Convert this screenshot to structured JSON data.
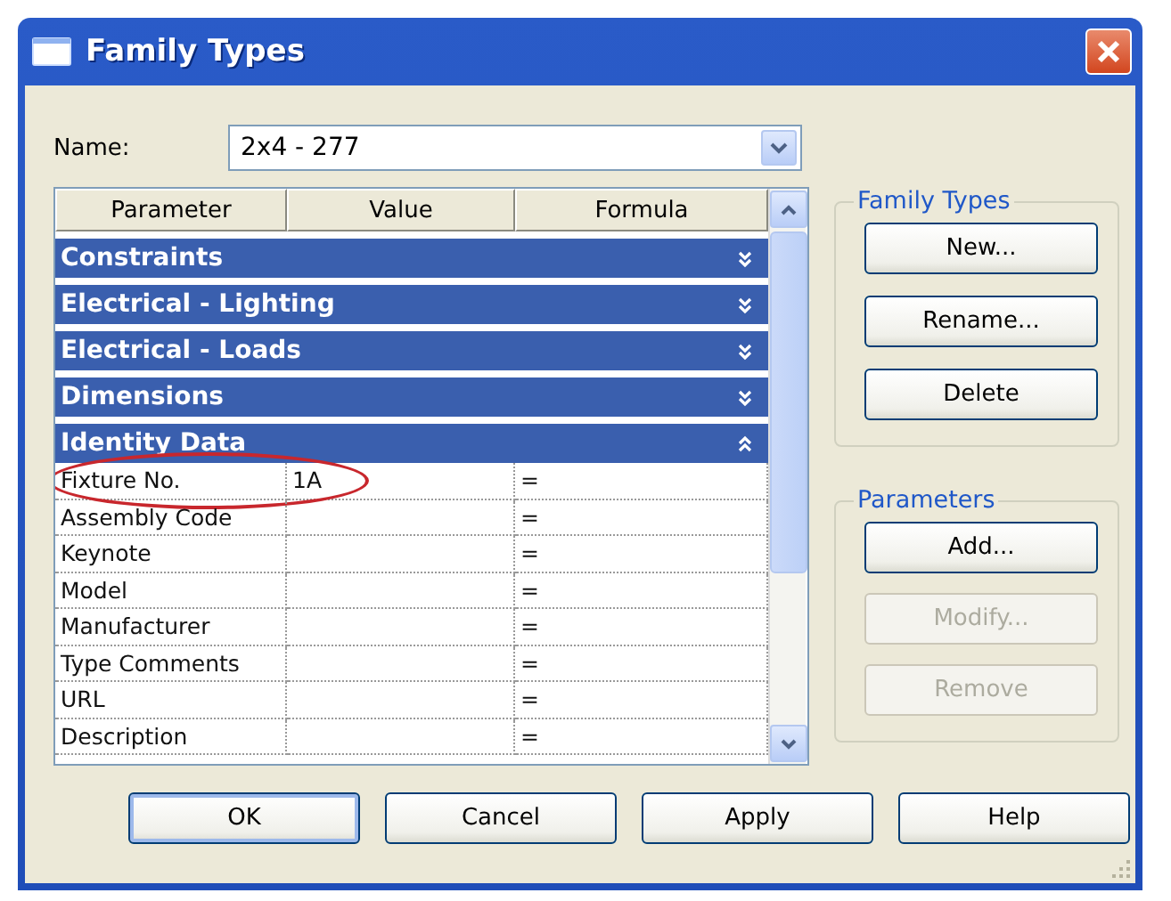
{
  "window": {
    "title": "Family Types"
  },
  "name_field": {
    "label": "Name:",
    "value": "2x4 - 277"
  },
  "table": {
    "columns": [
      "Parameter",
      "Value",
      "Formula"
    ],
    "groups": [
      {
        "label": "Constraints",
        "expanded": false
      },
      {
        "label": "Electrical - Lighting",
        "expanded": false
      },
      {
        "label": "Electrical - Loads",
        "expanded": false
      },
      {
        "label": "Dimensions",
        "expanded": false
      },
      {
        "label": "Identity Data",
        "expanded": true,
        "rows": [
          {
            "parameter": "Fixture No.",
            "value": "1A",
            "formula": "=",
            "highlighted": true
          },
          {
            "parameter": "Assembly Code",
            "formula": "=",
            "highlighted": false
          },
          {
            "parameter": "Keynote",
            "formula": "=",
            "highlighted": false
          },
          {
            "parameter": "Model",
            "formula": "=",
            "highlighted": false
          },
          {
            "parameter": "Manufacturer",
            "formula": "=",
            "highlighted": false
          },
          {
            "parameter": "Type Comments",
            "formula": "=",
            "highlighted": false
          },
          {
            "parameter": "URL",
            "formula": "=",
            "highlighted": false
          },
          {
            "parameter": "Description",
            "formula": "=",
            "highlighted": false
          }
        ]
      }
    ]
  },
  "side_groups": [
    {
      "title": "Family Types",
      "buttons": [
        {
          "label": "New...",
          "disabled": false
        },
        {
          "label": "Rename...",
          "disabled": false
        },
        {
          "label": "Delete",
          "disabled": false
        }
      ]
    },
    {
      "title": "Parameters",
      "buttons": [
        {
          "label": "Add...",
          "disabled": false
        },
        {
          "label": "Modify...",
          "disabled": true
        },
        {
          "label": "Remove",
          "disabled": true
        }
      ]
    }
  ],
  "buttons": [
    {
      "label": "OK",
      "default": true
    },
    {
      "label": "Cancel",
      "default": false
    },
    {
      "label": "Apply",
      "default": false
    },
    {
      "label": "Help",
      "default": false
    }
  ]
}
